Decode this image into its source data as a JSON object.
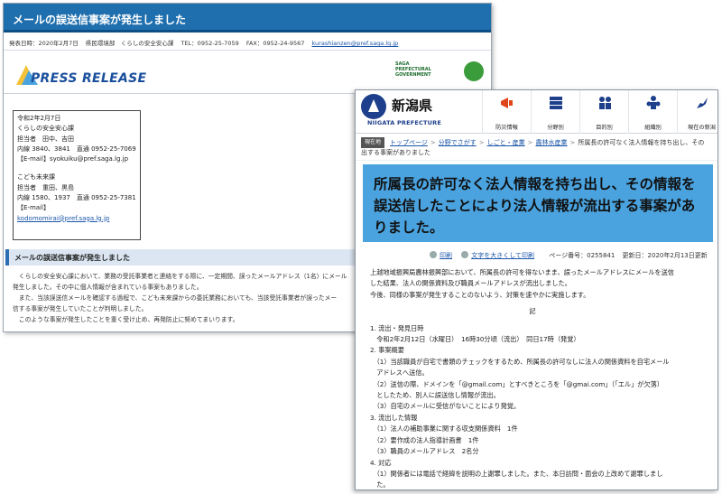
{
  "saga": {
    "title": "メールの誤送信事案が発生しました",
    "meta": {
      "date": "発表日時：2020年2月7日",
      "dept": "県民環境部　くらしの安全安心課",
      "tel": "TEL：0952-25-7059",
      "fax": "FAX：0952-24-9567",
      "email": "kurashianzen@pref.saga.lg.jp"
    },
    "press_release": "PRESS RELEASE",
    "gov_lines": [
      "SAGA",
      "PREFECTURAL",
      "GOVERNMENT"
    ],
    "contact_lines": [
      "令和2年2月7日",
      "くらしの安全安心課",
      "担当者　田中、吉田",
      "内線 3840、3841　直通 0952-25-7069",
      "【E-mail】syokuiku@pref.saga.lg.jp",
      "",
      "こども未来課",
      "担当者　重田、黒島",
      "内線 1580、1937　直通 0952-25-7381",
      "【E-mail】",
      "kodomomirai@pref.saga.lg.jp"
    ],
    "section_head": "メールの誤送信事案が発生しました",
    "body_lines": [
      "　くらしの安全安心課において、業務の受託事業者と連絡をする際に、一定期間、誤ったメールアドレス（1名）にメール",
      "発生しました。その中に個人情報が含まれている事案もありました。",
      "　また、当該誤送信メールを確認する過程で、こども未来課からの委託業務においても、当該受託事業者が誤ったメー",
      "信する事案が発生していたことが判明しました。",
      "　このような事案が発生したことを重く受け止め、再発防止に努めてまいります。"
    ]
  },
  "niigata": {
    "logo_ja": "新潟県",
    "logo_en": "NIIGATA PREFECTURE",
    "nav": [
      {
        "label": "防災情報",
        "icon": "megaphone-icon",
        "color": "#e0441a"
      },
      {
        "label": "分野別",
        "icon": "stack-icon",
        "color": "#1d3f8c"
      },
      {
        "label": "目的別",
        "icon": "people-icon",
        "color": "#1d3f8c"
      },
      {
        "label": "組織別",
        "icon": "org-icon",
        "color": "#1d3f8c"
      },
      {
        "label": "現在の新潟",
        "icon": "map-icon",
        "color": "#1d3f8c"
      }
    ],
    "badge": "現在地",
    "crumbs": [
      "トップページ",
      "分野でさがす",
      "しごと・産業",
      "農林水産業"
    ],
    "crumb_current": "所属長の許可なく法人情報を持ち出し、その情報を誤送信したことにより法人情報が流出する事案が発生しました",
    "crumb_current_l1": "所属長の許可なく法人情報を持ち出し、その",
    "crumb_current_l2": "出する事案がありました",
    "title_lines": [
      "所属長の許可なく法人情報を持ち出し、その情報を",
      "誤送信したことにより法人情報が流出する事案があ",
      "りました。"
    ],
    "tools": {
      "print": "印刷",
      "bigprint": "文字を大きくして印刷",
      "page_no": "ページ番号：0255841",
      "updated": "更新日：2020年2月13日更新"
    },
    "content_lines": [
      "上越地域振興局農林振興部において、所属長の許可を得ないまま、誤ったメールアドレスにメールを送信",
      "した結果、法人の関係資料及び職員メールアドレスが流出しました。",
      "今後、同様の事案が発生することのないよう、対策を速やかに実施します。"
    ],
    "ki": "記",
    "list_lines": [
      "1. 流出・発見日時",
      "　令和2年2月12日（水曜日）　16時30分頃（流出）　同日17時（発覚）",
      "2. 事案概要",
      "　（1）当該職員が自宅で書類のチェックをするため、所属長の許可なしに法人の関係資料を自宅メール",
      "　アドレスへ送信。",
      "　（2）送信の際、ドメインを「@gmail.com」とすべきところを「@gmai.com」（「エル」が欠落）",
      "　としたため、別人に誤送信し情報が流出。",
      "　（3）自宅のメールに受信がないことにより発覚。",
      "3. 流出した情報",
      "　（1）法人の補助事業に関する収支関係資料　1件",
      "　（2）要作成の法人指導計画書　1件",
      "　（3）職員のメールアドレス　2名分",
      "4. 対応",
      "　（1）関係者には電話で経緯を説明の上謝罪しました。また、本日訪問・面会の上改めて謝罪しまし",
      "　た。"
    ]
  }
}
